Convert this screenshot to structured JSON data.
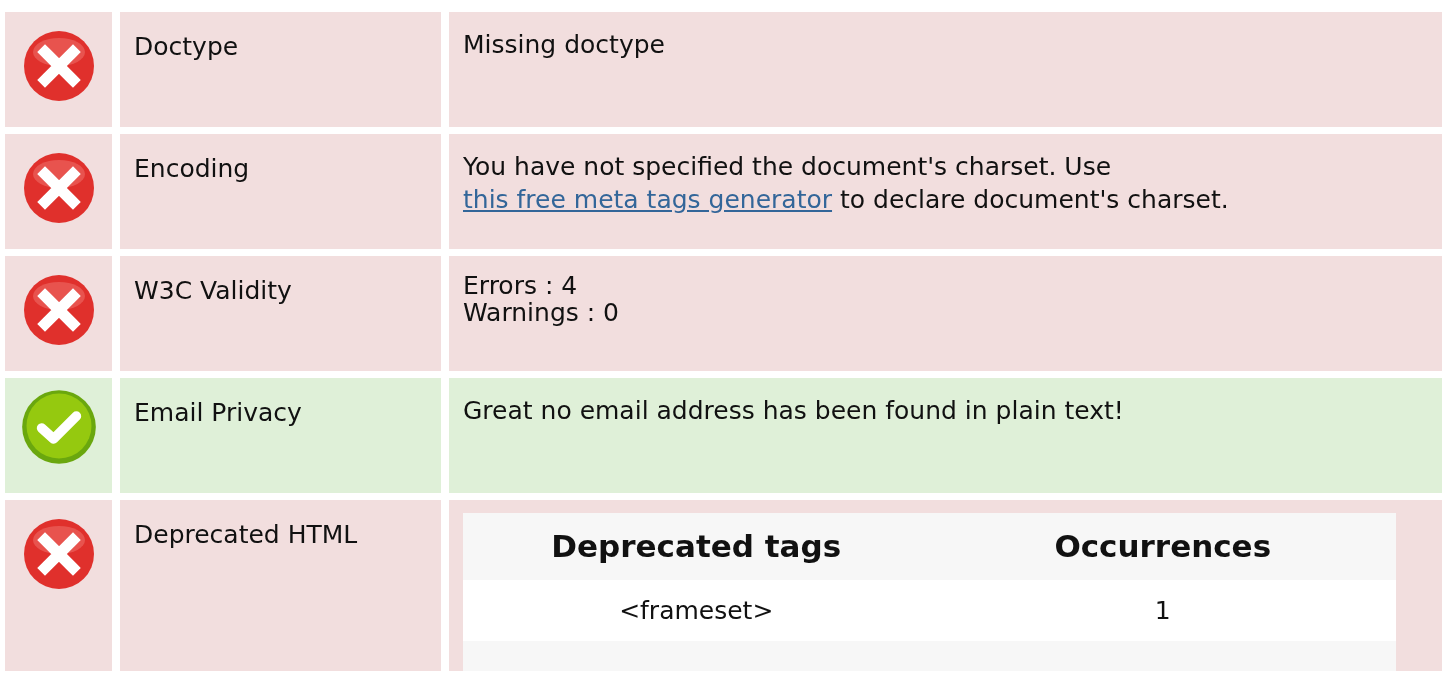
{
  "rows": [
    {
      "passed": false,
      "label": "Doctype",
      "value": {
        "kind": "text",
        "text": "Missing doctype"
      }
    },
    {
      "passed": false,
      "label": "Encoding",
      "value": {
        "kind": "link_sentence",
        "before": "You have not specified the document's charset. Use ",
        "link": "this free meta tags generator",
        "after": " to declare document's charset."
      }
    },
    {
      "passed": false,
      "label": "W3C Validity",
      "value": {
        "kind": "lines",
        "lines": [
          "Errors : 4",
          "Warnings : 0"
        ]
      }
    },
    {
      "passed": true,
      "label": "Email Privacy",
      "value": {
        "kind": "text",
        "text": "Great no email address has been found in plain text!"
      }
    },
    {
      "passed": false,
      "label": "Deprecated HTML",
      "value": {
        "kind": "table",
        "columns": [
          "Deprecated tags",
          "Occurrences"
        ],
        "rows": [
          [
            "<frameset>",
            "1"
          ]
        ]
      }
    }
  ]
}
